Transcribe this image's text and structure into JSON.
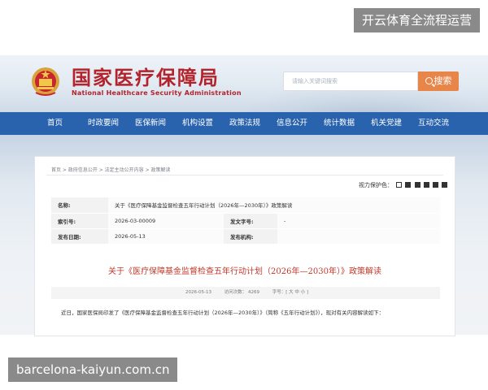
{
  "watermark_top": "开云体育全流程运营",
  "watermark_bottom": "barcelona-kaiyun.com.cn",
  "header": {
    "site_name": "国家医疗保障局",
    "site_name_en": "National Healthcare Security Administration",
    "search_placeholder": "请输入关键词搜索",
    "search_button": "搜索",
    "colors": {
      "brand_red": "#b4232b",
      "nav_blue": "#2a63ad",
      "search_orange": "#e8864a"
    }
  },
  "nav": {
    "items": [
      {
        "label": "首页"
      },
      {
        "label": "时政要闻"
      },
      {
        "label": "医保新闻"
      },
      {
        "label": "机构设置"
      },
      {
        "label": "政策法规"
      },
      {
        "label": "信息公开"
      },
      {
        "label": "统计数据"
      },
      {
        "label": "机关党建"
      },
      {
        "label": "互动交流"
      }
    ]
  },
  "content": {
    "breadcrumb": "首页 > 政府信息公开 > 法定主动公开内容 > 政策解读",
    "vision_label": "视力保护色：",
    "meta": {
      "name_label": "名称:",
      "name_value": "关于《医疗保障基金监督检查五年行动计划（2026年—2030年）》政策解读",
      "index_label": "索引号:",
      "index_value": "2026-03-00009",
      "doc_no_label": "发文字号:",
      "doc_no_value": "-",
      "date_label": "发布日期:",
      "date_value": "2026-05-13",
      "org_label": "发布机构:",
      "org_value": ""
    },
    "article_title": "关于《医疗保障基金监督检查五年行动计划（2026年—2030年）》政策解读",
    "info_bar": {
      "date": "2026-05-13",
      "views": "访问次数： 4269",
      "font_size": "字号：[ 大 中 小 ]"
    },
    "body": "近日，国家医保局印发了《医疗保障基金监督检查五年行动计划（2026年—2030年）》（简称《五年行动计划》），现对有关内容解读如下："
  }
}
